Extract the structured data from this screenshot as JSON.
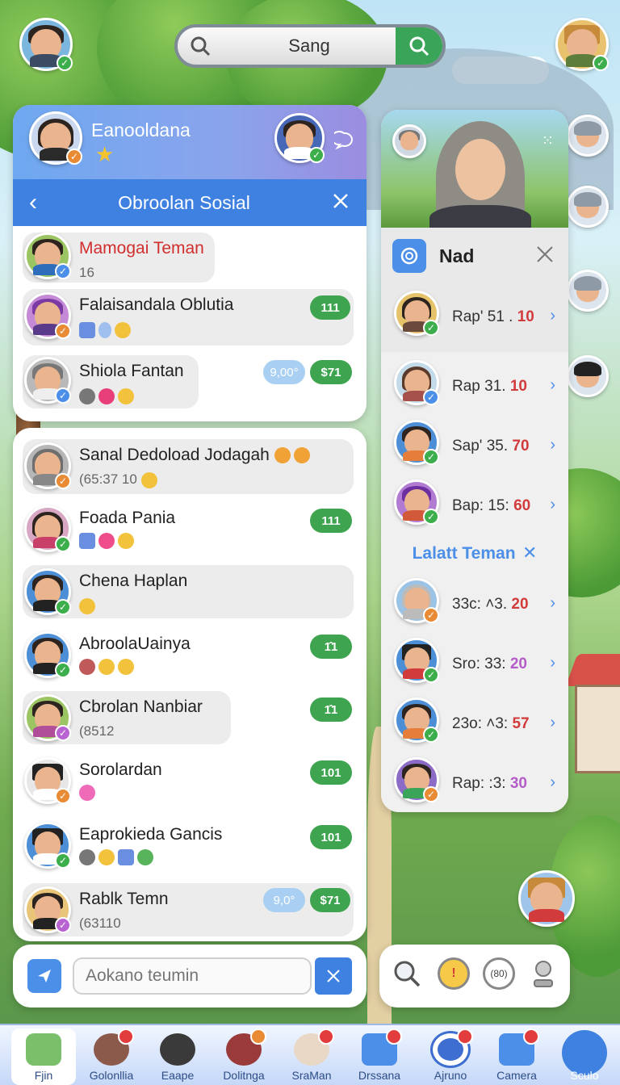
{
  "search": {
    "query": "Sang"
  },
  "top_panel": {
    "profile_name": "Eanooldana",
    "title": "Obroolan Sosial",
    "chats": [
      {
        "name": "Mamogai Teman",
        "sub": "16"
      },
      {
        "name": "Falaisandala Oblutia",
        "count": "1​1​1"
      },
      {
        "name": "Shiola Fantan",
        "tag": "9,00°",
        "count": "$71"
      }
    ]
  },
  "chat_list": [
    {
      "name": "Sanal Dedoload Jodagah",
      "sub": "(65:37  10"
    },
    {
      "name": "Foada Pania",
      "count": "111"
    },
    {
      "name": "Chena Haplan"
    },
    {
      "name": "AbroolaUainya",
      "count": "1̂1"
    },
    {
      "name": "Cbrolan Nanbiar",
      "sub": "(8512",
      "count": "1̂1"
    },
    {
      "name": "Sorolardan",
      "count": "101"
    },
    {
      "name": "Eaprokieda Gancis",
      "count": "101"
    },
    {
      "name": "Rablk Temn",
      "sub": "(63110",
      "tag": "9,0°",
      "count": "$71"
    }
  ],
  "right_panel": {
    "header": "Nad",
    "rows_top": [
      {
        "text": "Rap' 51 .",
        "num": "10",
        "num_color": "#d23b3b"
      },
      {
        "text": "Rap 31.",
        "num": "10",
        "num_color": "#d23b3b"
      },
      {
        "text": "Sap' 35.",
        "num": "70",
        "num_color": "#d23b3b"
      },
      {
        "text": "Bap: 15:",
        "num": "60",
        "num_color": "#d23b3b"
      }
    ],
    "section_label": "Lalatt Teman",
    "rows_bottom": [
      {
        "text": "33c: ˄3.",
        "num": "20",
        "num_color": "#d23b3b"
      },
      {
        "text": "Sro: 33:",
        "num": "20",
        "num_color": "#b45cc7"
      },
      {
        "text": "23o: ˄3:",
        "num": "57",
        "num_color": "#d23b3b"
      },
      {
        "text": "Rap: :3:",
        "num": "30",
        "num_color": "#b45cc7"
      }
    ]
  },
  "composer": {
    "placeholder": "Aokano teumin"
  },
  "tools": {
    "counter_label": "(80)"
  },
  "nav": [
    {
      "label": "Fjin"
    },
    {
      "label": "Golonllia"
    },
    {
      "label": "Eaape"
    },
    {
      "label": "Dolitnga"
    },
    {
      "label": "SraMan"
    },
    {
      "label": "Drssana"
    },
    {
      "label": "Ajruno"
    },
    {
      "label": "Camera"
    },
    {
      "label": "Sculo"
    }
  ]
}
